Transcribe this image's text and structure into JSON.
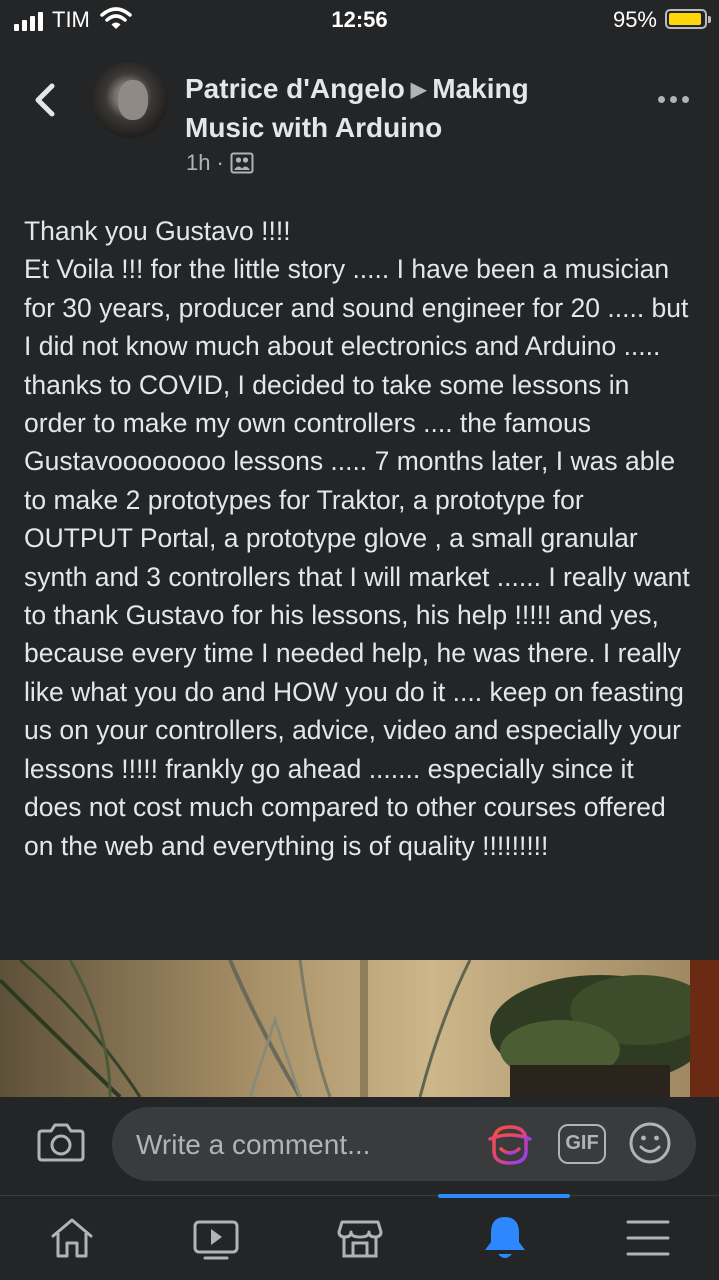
{
  "status_bar": {
    "carrier": "TIM",
    "time": "12:56",
    "battery": "95%",
    "battery_level": 0.95
  },
  "post": {
    "author": "Patrice d'Angelo",
    "group": "Making Music with Arduino",
    "time": "1h",
    "body": "Thank you Gustavo !!!!\nEt Voila !!! for the little story ..... I have been a musician for 30 years, producer and sound engineer for 20 ..... but I did not know much about electronics and Arduino ..... thanks to COVID, I decided to take some lessons in order to make my own controllers .... the famous Gustavoooooooo lessons ..... 7 months later, I was able to make 2 prototypes for Traktor, a prototype for OUTPUT Portal, a prototype glove , a small granular synth and 3 controllers that I will market ...... I really want to thank Gustavo for his lessons, his help !!!!! and yes, because every time I needed help, he was there. I really like what you do and HOW you do it .... keep on feasting us on your controllers, advice, video and especially your lessons !!!!! frankly go ahead ....... especially since it does not cost much compared to other courses offered on the web and everything is of quality !!!!!!!!!"
  },
  "comment_bar": {
    "placeholder": "Write a comment...",
    "gif_label": "GIF"
  },
  "icons": {
    "back": "chevron-left-icon",
    "more": "more-horizontal-icon",
    "audience": "group-icon",
    "camera": "camera-icon",
    "avatar_sticker": "avatar-sticker-icon",
    "emoji": "smiley-icon",
    "nav": [
      "home-icon",
      "video-icon",
      "marketplace-icon",
      "bell-icon",
      "menu-icon"
    ]
  },
  "colors": {
    "background": "#242526",
    "accent": "#2d88ff",
    "text": "#e4e6eb",
    "secondary_text": "#b0b3b8"
  },
  "bottom_nav": {
    "active_tab": "notifications"
  }
}
